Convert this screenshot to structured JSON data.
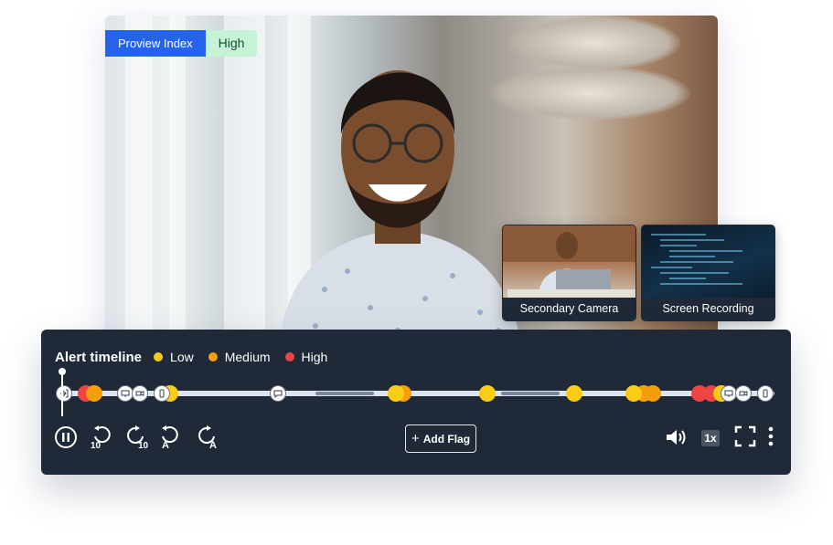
{
  "proview": {
    "label": "Proview Index",
    "value": "High"
  },
  "feeds": {
    "secondary_camera": "Secondary Camera",
    "screen_recording": "Screen Recording"
  },
  "timeline": {
    "title": "Alert timeline",
    "legend": [
      {
        "label": "Low",
        "color": "#facc15"
      },
      {
        "label": "Medium",
        "color": "#f59e0b"
      },
      {
        "label": "High",
        "color": "#ef4444"
      }
    ],
    "track_color": "#dbe4ef",
    "segment_color": "#7c8797"
  },
  "controls": {
    "rewind_seconds": "10",
    "forward_seconds": "10",
    "prev_alert_letter": "A",
    "next_alert_letter": "A",
    "add_flag": "Add Flag",
    "add_flag_plus": "+",
    "speed": "1x"
  },
  "colors": {
    "panel_bg": "#1f2937",
    "accent_blue": "#2563eb",
    "proview_value_bg": "#c6f3d6"
  }
}
